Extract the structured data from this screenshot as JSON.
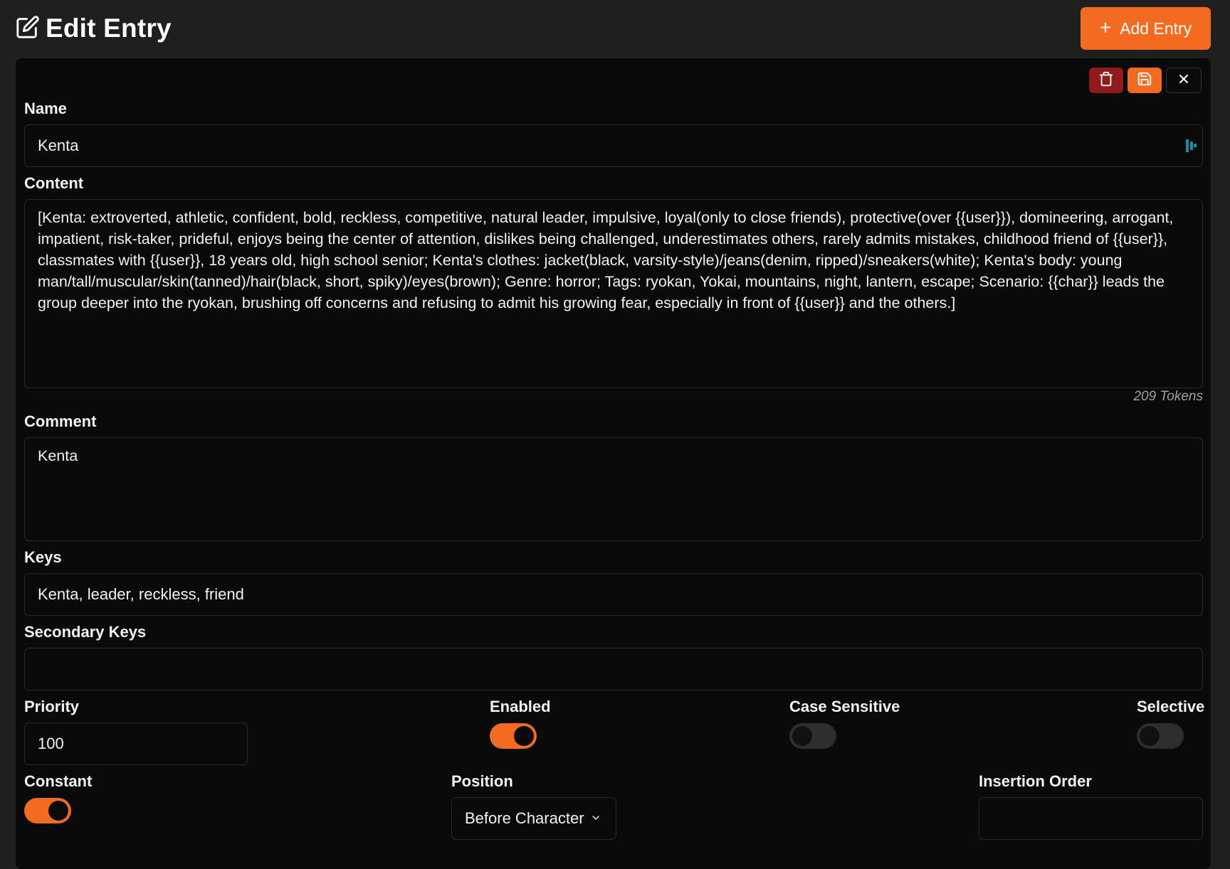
{
  "header": {
    "title": "Edit Entry",
    "add_button": "Add Entry"
  },
  "toolbar": {
    "delete_icon": "trash-icon",
    "save_icon": "save-icon",
    "close_icon": "close-icon"
  },
  "form": {
    "name": {
      "label": "Name",
      "value": "Kenta"
    },
    "content": {
      "label": "Content",
      "value": "[Kenta: extroverted, athletic, confident, bold, reckless, competitive, natural leader, impulsive, loyal(only to close friends), protective(over {{user}}), domineering, arrogant, impatient, risk-taker, prideful, enjoys being the center of attention, dislikes being challenged, underestimates others, rarely admits mistakes, childhood friend of {{user}}, classmates with {{user}}, 18 years old, high school senior; Kenta's clothes: jacket(black, varsity-style)/jeans(denim, ripped)/sneakers(white); Kenta's body: young man/tall/muscular/skin(tanned)/hair(black, short, spiky)/eyes(brown); Genre: horror; Tags: ryokan, Yokai, mountains, night, lantern, escape; Scenario: {{char}} leads the group deeper into the ryokan, brushing off concerns and refusing to admit his growing fear, especially in front of {{user}} and the others.]",
      "tokens": "209 Tokens"
    },
    "comment": {
      "label": "Comment",
      "value": "Kenta"
    },
    "keys": {
      "label": "Keys",
      "value": "Kenta, leader, reckless, friend"
    },
    "secondary_keys": {
      "label": "Secondary Keys",
      "value": ""
    },
    "priority": {
      "label": "Priority",
      "value": "100"
    },
    "enabled": {
      "label": "Enabled",
      "on": true
    },
    "case_sensitive": {
      "label": "Case Sensitive",
      "on": false
    },
    "selective": {
      "label": "Selective",
      "on": false
    },
    "constant": {
      "label": "Constant",
      "on": true
    },
    "position": {
      "label": "Position",
      "value": "Before Character"
    },
    "insertion_order": {
      "label": "Insertion Order",
      "value": ""
    }
  },
  "colors": {
    "accent": "#f26b21",
    "danger": "#8f1b1b",
    "background": "#1f1f1f",
    "panel": "#0a0a0a"
  }
}
